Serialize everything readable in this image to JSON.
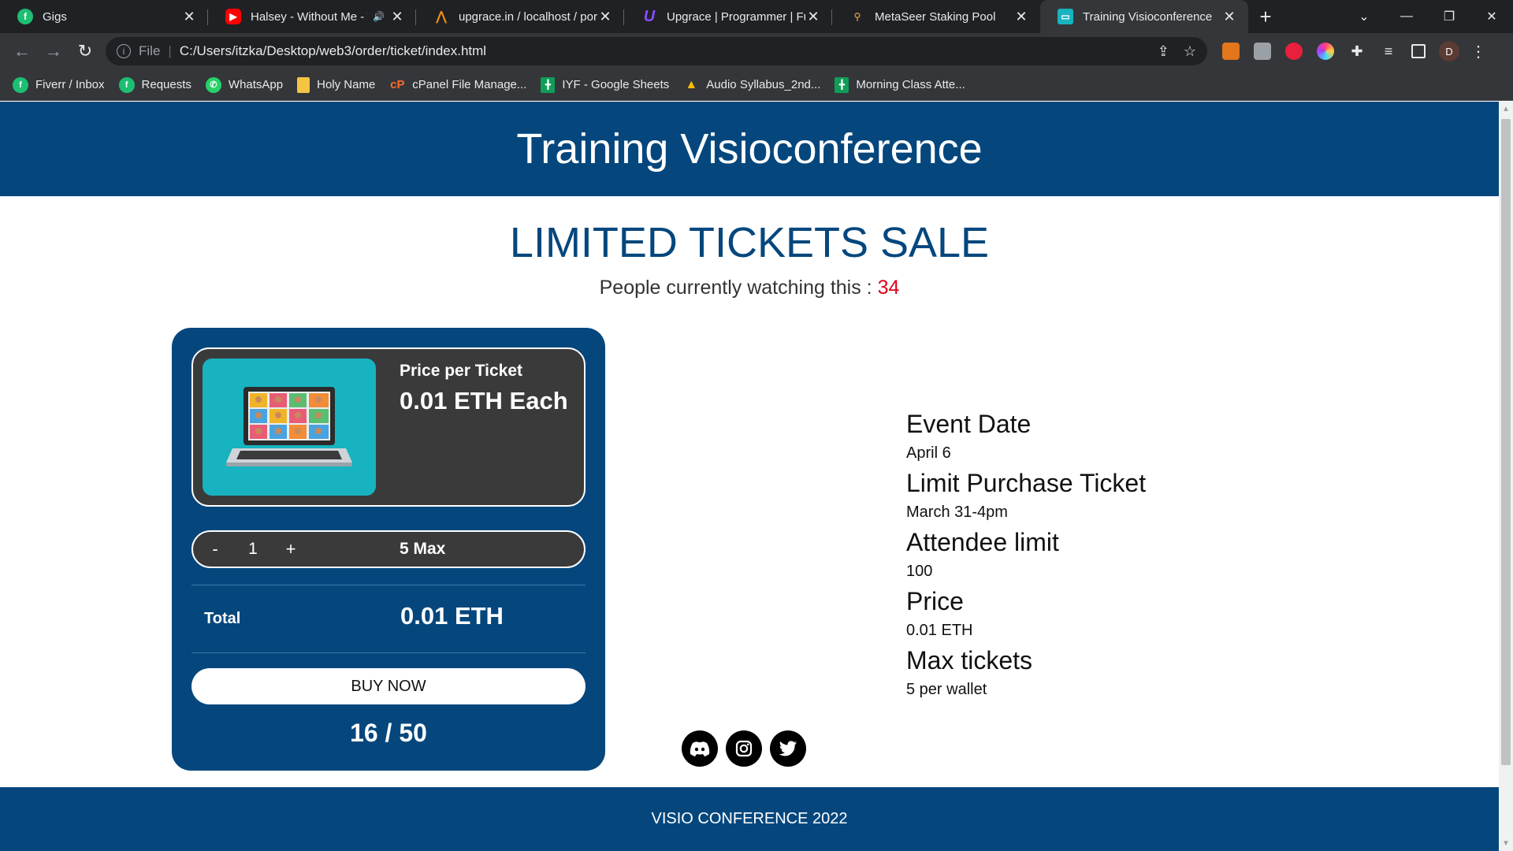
{
  "browser": {
    "tabs": [
      {
        "title": "Gigs",
        "icon": "fiverr-icon",
        "color": "#1dbf73",
        "active": false
      },
      {
        "title": "Halsey - Without Me - Y",
        "icon": "youtube-icon",
        "color": "#ff0000",
        "active": false,
        "audio": true
      },
      {
        "title": "upgrace.in / localhost / por",
        "icon": "phpmyadmin-icon",
        "color": "#f29111",
        "active": false
      },
      {
        "title": "Upgrace | Programmer | Ful",
        "icon": "upgrace-icon",
        "color": "#6b2fd9",
        "active": false
      },
      {
        "title": "MetaSeer Staking Pool",
        "icon": "metaseer-icon",
        "color": "#c08a3e",
        "active": false
      },
      {
        "title": "Training Visioconference",
        "icon": "page-icon",
        "color": "#17b3c0",
        "active": true
      }
    ],
    "address": {
      "scheme_label": "File",
      "url": "C:/Users/itzka/Desktop/web3/order/ticket/index.html"
    },
    "profile_initial": "D",
    "bookmarks": [
      {
        "label": "Fiverr / Inbox",
        "icon": "fiverr-icon",
        "color": "#1dbf73"
      },
      {
        "label": "Requests",
        "icon": "fiverr-icon",
        "color": "#1dbf73"
      },
      {
        "label": "WhatsApp",
        "icon": "whatsapp-icon",
        "color": "#25d366"
      },
      {
        "label": "Holy Name",
        "icon": "note-icon",
        "color": "#f4c542"
      },
      {
        "label": "cPanel File Manage...",
        "icon": "cpanel-icon",
        "color": "#ff6c2c"
      },
      {
        "label": "IYF - Google Sheets",
        "icon": "sheets-icon",
        "color": "#0f9d58"
      },
      {
        "label": "Audio Syllabus_2nd...",
        "icon": "drive-icon",
        "color": "#fbbc04"
      },
      {
        "label": "Morning Class Atte...",
        "icon": "sheets-icon",
        "color": "#0f9d58"
      }
    ]
  },
  "page": {
    "header_title": "Training Visioconference",
    "sale_title": "LIMITED TICKETS SALE",
    "watching_label": "People currently watching this :",
    "watching_count": "34",
    "card": {
      "price_label": "Price per Ticket",
      "price_value": "0.01 ETH Each",
      "qty_minus": "-",
      "qty_value": "1",
      "qty_plus": "+",
      "qty_max": "5 Max",
      "total_label": "Total",
      "total_value": "0.01 ETH",
      "buy_label": "BUY NOW",
      "sold_counter": "16 / 50"
    },
    "socials": [
      "discord-icon",
      "instagram-icon",
      "twitter-icon"
    ],
    "details": [
      {
        "heading": "Event Date",
        "value": "April 6"
      },
      {
        "heading": "Limit Purchase Ticket",
        "value": "March 31-4pm"
      },
      {
        "heading": "Attendee limit",
        "value": "100"
      },
      {
        "heading": "Price",
        "value": "0.01 ETH"
      },
      {
        "heading": "Max tickets",
        "value": "5 per wallet"
      }
    ],
    "footer": "VISIO CONFERENCE 2022"
  },
  "colors": {
    "brand": "#05477d",
    "accent_red": "#e0001b",
    "card_inner": "#3a3a3b",
    "thumb_bg": "#17b3c0"
  }
}
